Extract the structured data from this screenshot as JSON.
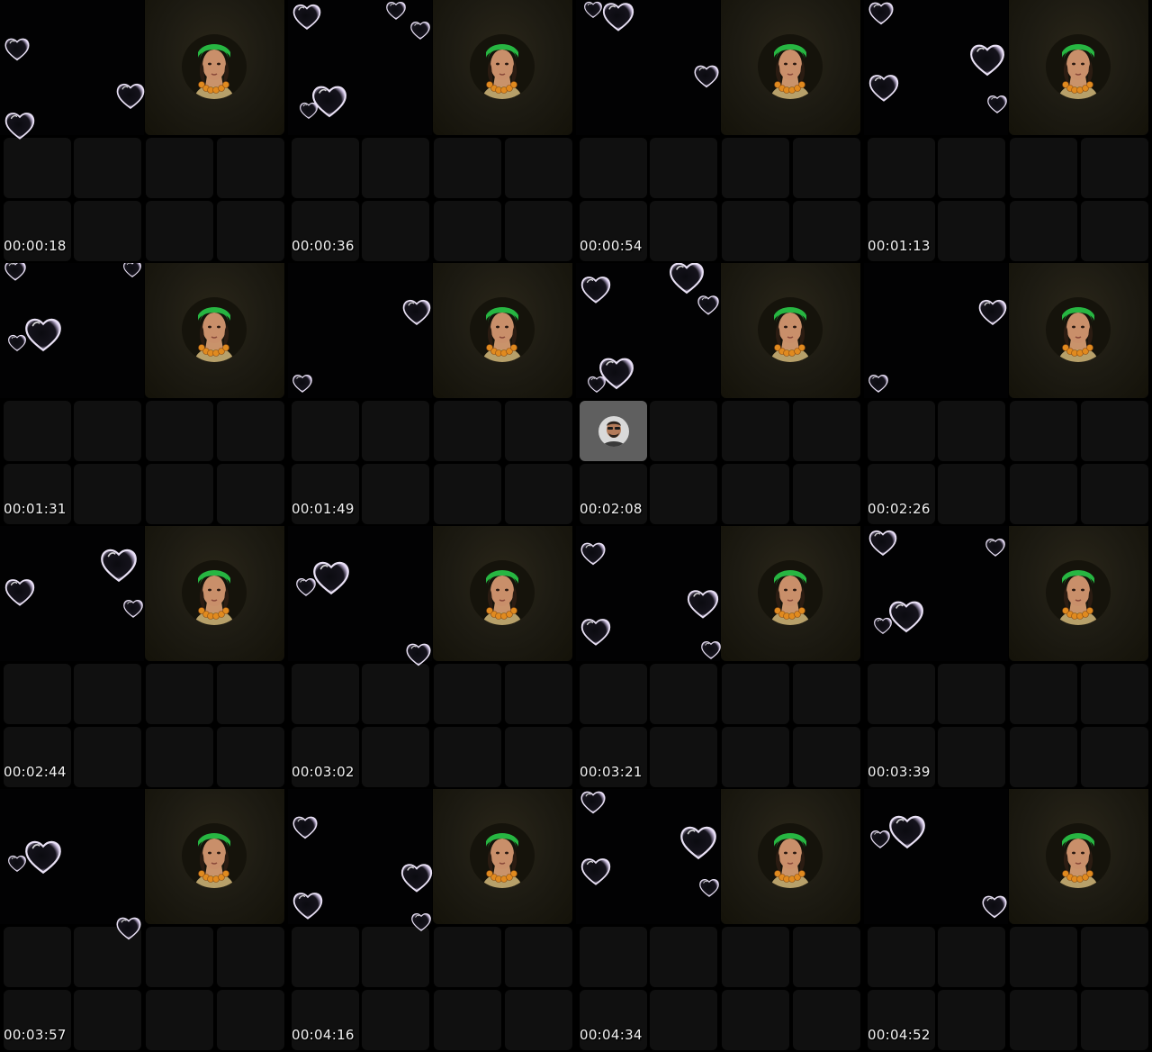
{
  "frames": [
    {
      "timestamp": "00:00:18",
      "guest_avatar": false,
      "hearts": [
        [
          4,
          40,
          30
        ],
        [
          128,
          90,
          34
        ],
        [
          4,
          122,
          36
        ]
      ]
    },
    {
      "timestamp": "00:00:36",
      "guest_avatar": false,
      "hearts": [
        [
          324,
          2,
          34
        ],
        [
          345,
          92,
          42
        ],
        [
          332,
          112,
          22
        ],
        [
          455,
          22,
          24
        ],
        [
          428,
          0,
          24
        ]
      ]
    },
    {
      "timestamp": "00:00:54",
      "guest_avatar": false,
      "hearts": [
        [
          648,
          0,
          22
        ],
        [
          668,
          0,
          38
        ],
        [
          770,
          70,
          30
        ]
      ]
    },
    {
      "timestamp": "00:01:13",
      "guest_avatar": false,
      "hearts": [
        [
          964,
          0,
          30
        ],
        [
          1076,
          46,
          42
        ],
        [
          964,
          80,
          36
        ],
        [
          1096,
          104,
          24
        ]
      ]
    },
    {
      "timestamp": "00:01:31",
      "guest_avatar": false,
      "hearts": [
        [
          4,
          288,
          26
        ],
        [
          26,
          350,
          44
        ],
        [
          8,
          370,
          22
        ],
        [
          136,
          288,
          22
        ]
      ]
    },
    {
      "timestamp": "00:01:49",
      "guest_avatar": false,
      "hearts": [
        [
          446,
          330,
          34
        ],
        [
          324,
          414,
          24
        ]
      ]
    },
    {
      "timestamp": "00:02:08",
      "guest_avatar": true,
      "hearts": [
        [
          644,
          304,
          36
        ],
        [
          664,
          394,
          42
        ],
        [
          652,
          416,
          22
        ],
        [
          774,
          326,
          26
        ],
        [
          742,
          288,
          42
        ]
      ]
    },
    {
      "timestamp": "00:02:26",
      "guest_avatar": false,
      "hearts": [
        [
          1086,
          330,
          34
        ],
        [
          964,
          414,
          24
        ]
      ]
    },
    {
      "timestamp": "00:02:44",
      "guest_avatar": false,
      "hearts": [
        [
          110,
          606,
          44
        ],
        [
          4,
          640,
          36
        ],
        [
          136,
          664,
          24
        ]
      ]
    },
    {
      "timestamp": "00:03:02",
      "guest_avatar": false,
      "hearts": [
        [
          346,
          620,
          44
        ],
        [
          328,
          640,
          24
        ],
        [
          450,
          712,
          30
        ]
      ]
    },
    {
      "timestamp": "00:03:21",
      "guest_avatar": false,
      "hearts": [
        [
          644,
          600,
          30
        ],
        [
          762,
          652,
          38
        ],
        [
          644,
          684,
          36
        ],
        [
          778,
          710,
          24
        ]
      ]
    },
    {
      "timestamp": "00:03:39",
      "guest_avatar": false,
      "hearts": [
        [
          964,
          586,
          34
        ],
        [
          1094,
          596,
          24
        ],
        [
          986,
          664,
          42
        ],
        [
          970,
          684,
          22
        ]
      ]
    },
    {
      "timestamp": "00:03:57",
      "guest_avatar": false,
      "hearts": [
        [
          26,
          930,
          44
        ],
        [
          8,
          948,
          22
        ],
        [
          128,
          1016,
          30
        ]
      ]
    },
    {
      "timestamp": "00:04:16",
      "guest_avatar": false,
      "hearts": [
        [
          324,
          904,
          30
        ],
        [
          444,
          956,
          38
        ],
        [
          324,
          988,
          36
        ],
        [
          456,
          1012,
          24
        ]
      ]
    },
    {
      "timestamp": "00:04:34",
      "guest_avatar": false,
      "hearts": [
        [
          754,
          914,
          44
        ],
        [
          644,
          950,
          36
        ],
        [
          776,
          974,
          24
        ],
        [
          644,
          876,
          30
        ]
      ]
    },
    {
      "timestamp": "00:04:52",
      "guest_avatar": false,
      "hearts": [
        [
          986,
          902,
          44
        ],
        [
          966,
          920,
          24
        ],
        [
          1090,
          992,
          30
        ]
      ]
    }
  ]
}
